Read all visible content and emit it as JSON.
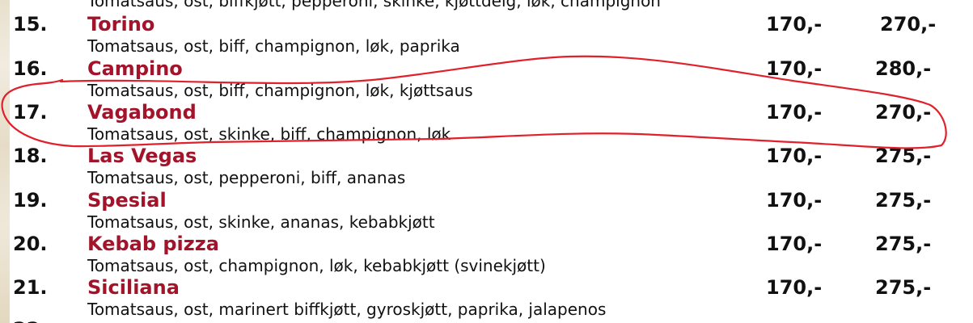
{
  "top_partial_desc": "Tomatsaus, ost, biffkjøtt, pepperoni, skinke, kjøttdeig, løk, champignon",
  "items": [
    {
      "num": "15.",
      "name": "Torino",
      "desc": "Tomatsaus, ost, biff, champignon, løk, paprika",
      "price_small": "170,-",
      "price_large": "270,-"
    },
    {
      "num": "16.",
      "name": "Campino",
      "desc": "Tomatsaus, ost, biff, champignon, løk, kjøttsaus",
      "price_small": "170,-",
      "price_large": "280,-"
    },
    {
      "num": "17.",
      "name": "Vagabond",
      "desc": "Tomatsaus, ost, skinke, biff, champignon, løk",
      "price_small": "170,-",
      "price_large": "270,-"
    },
    {
      "num": "18.",
      "name": "Las Vegas",
      "desc": "Tomatsaus, ost, pepperoni, biff, ananas",
      "price_small": "170,-",
      "price_large": "275,-"
    },
    {
      "num": "19.",
      "name": "Spesial",
      "desc": "Tomatsaus, ost, skinke, ananas, kebabkjøtt",
      "price_small": "170,-",
      "price_large": "275,-"
    },
    {
      "num": "20.",
      "name": "Kebab pizza",
      "desc": "Tomatsaus, ost, champignon, løk, kebabkjøtt (svinekjøtt)",
      "price_small": "170,-",
      "price_large": "275,-"
    },
    {
      "num": "21.",
      "name": "Siciliana",
      "desc": "Tomatsaus, ost, marinert biffkjøtt, gyroskjøtt, paprika, jalapenos",
      "price_small": "170,-",
      "price_large": "275,-"
    }
  ],
  "colors": {
    "name": "#a3142b",
    "text": "#111111",
    "annotation": "#e0202a"
  }
}
